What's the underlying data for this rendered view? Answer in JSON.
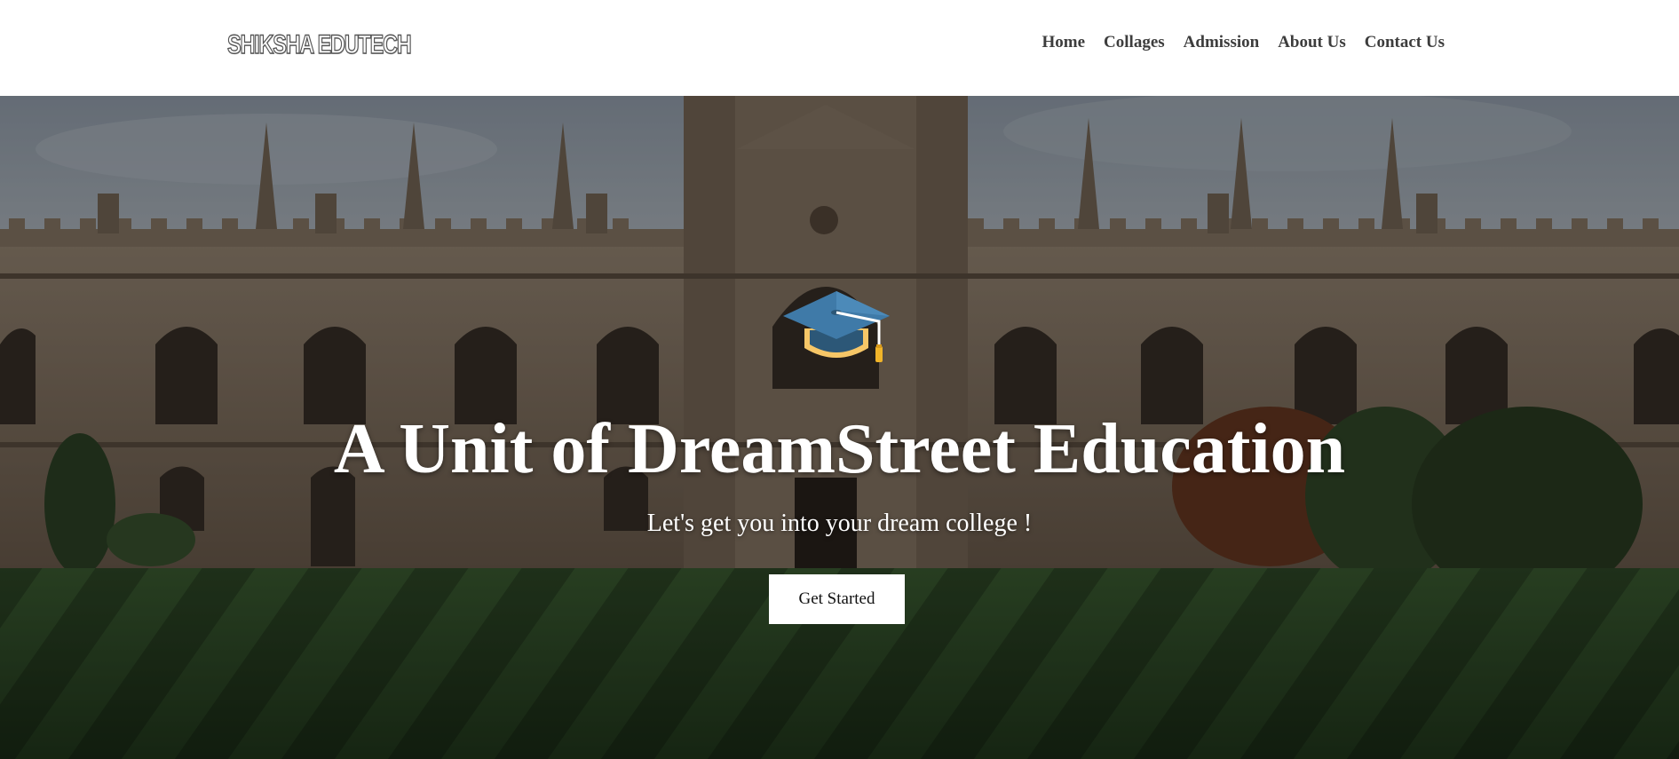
{
  "nav": {
    "brand": "SHIKSHA EDUTECH",
    "links": [
      {
        "label": "Home"
      },
      {
        "label": "Collages"
      },
      {
        "label": "Admission"
      },
      {
        "label": "About Us"
      },
      {
        "label": "Contact Us"
      }
    ]
  },
  "hero": {
    "title": "A Unit of DreamStreet Education",
    "subtitle": "Let's get you into your dream college !",
    "cta_label": "Get Started",
    "icon": "graduation-cap-icon",
    "background": "college-building-photo"
  },
  "colors": {
    "cap_blue": "#3f7aa8",
    "cap_dark": "#2c5777",
    "cap_band": "#f6c667",
    "tassel": "#f0b429",
    "stone": "#7b6a58",
    "lawn": "#2c4a26"
  }
}
